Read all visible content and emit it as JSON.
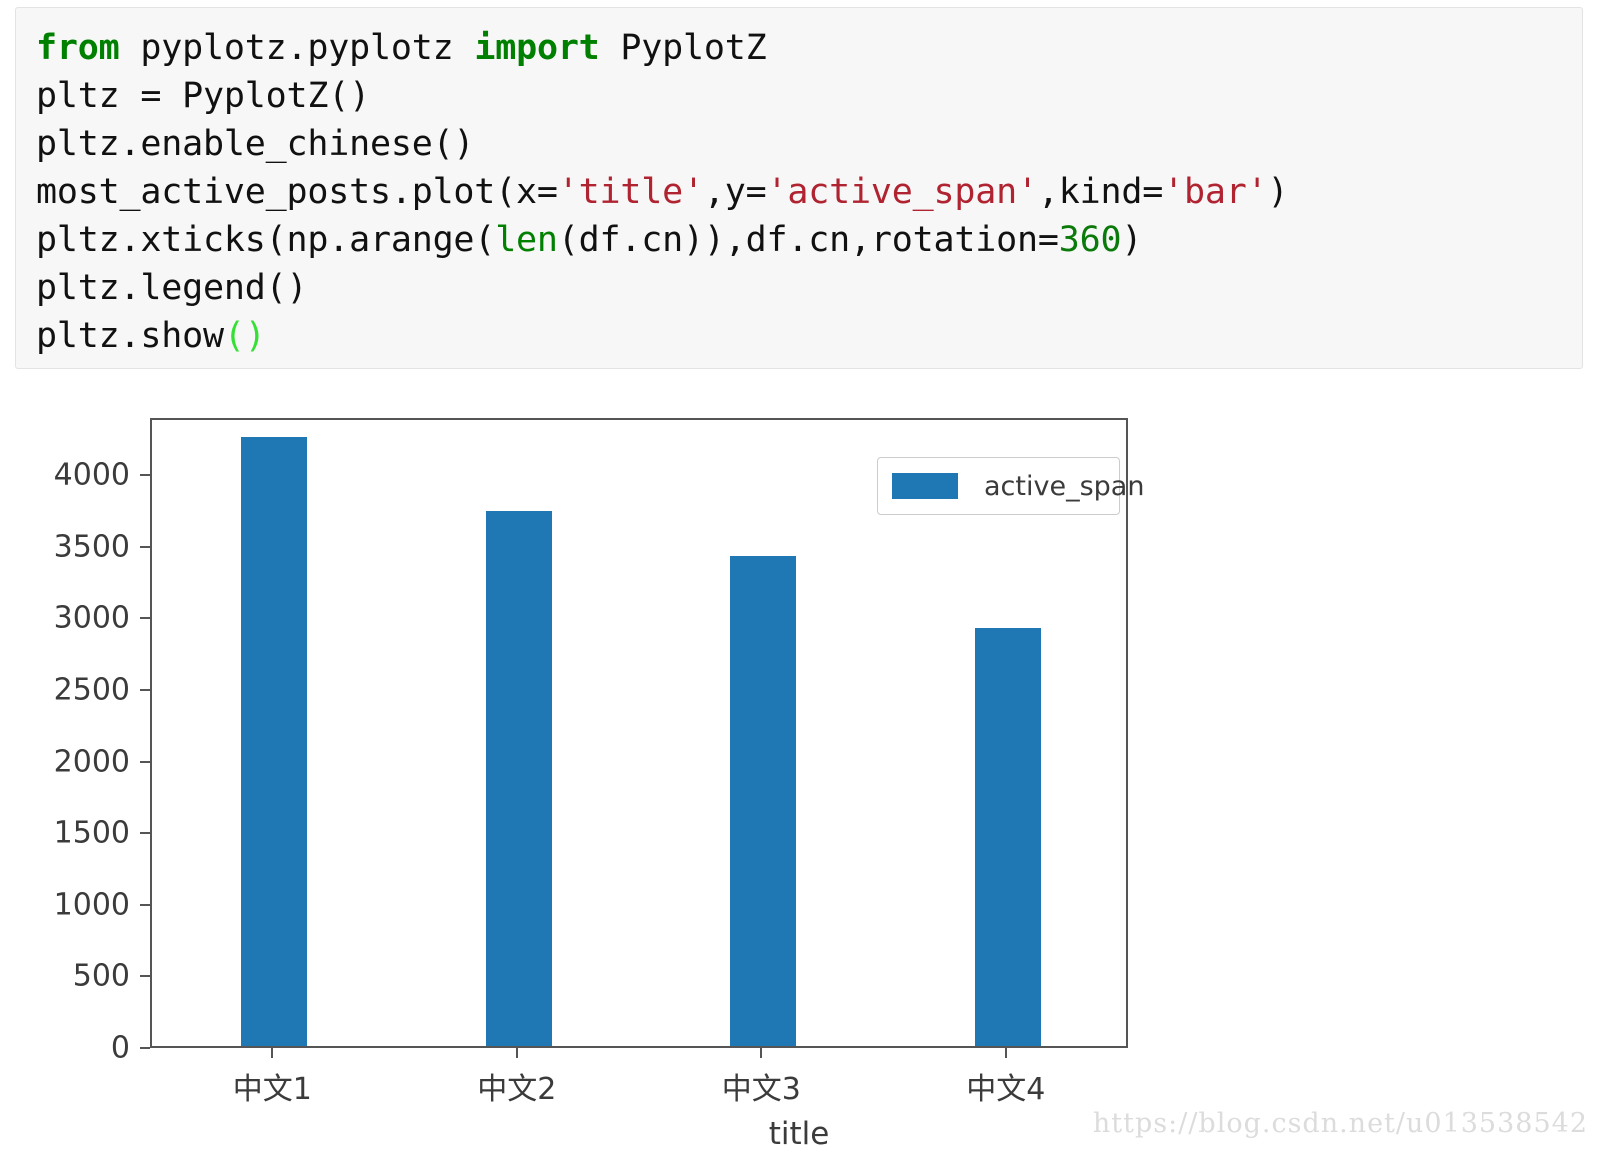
{
  "code_cell": {
    "language": "python",
    "lines": [
      {
        "id": "line1",
        "text": "from pyplotz.pyplotz import PyplotZ"
      },
      {
        "id": "line2",
        "text": "pltz = PyplotZ()"
      },
      {
        "id": "line3",
        "text": "pltz.enable_chinese()"
      },
      {
        "id": "line4",
        "text": "most_active_posts.plot(x='title',y='active_span',kind='bar')"
      },
      {
        "id": "line5",
        "text": "pltz.xticks(np.arange(len(df.cn)),df.cn,rotation=360)"
      },
      {
        "id": "line6",
        "text": "pltz.legend()"
      },
      {
        "id": "line7",
        "text": "pltz.show()"
      }
    ],
    "tokens": {
      "kw_from": "from",
      "kw_import": "import",
      "mod_path": " pyplotz.pyplotz ",
      "cls_name": " PyplotZ",
      "l2": "pltz = PyplotZ()",
      "l3": "pltz.enable_chinese()",
      "l4_a": "most_active_posts.plot(x=",
      "l4_s1": "'title'",
      "l4_b": ",y=",
      "l4_s2": "'active_span'",
      "l4_c": ",kind=",
      "l4_s3": "'bar'",
      "l4_d": ")",
      "l5_a": "pltz.xticks(np.arange(",
      "l5_len": "len",
      "l5_b": "(df.cn)),df.cn,rotation=",
      "l5_num": "360",
      "l5_c": ")",
      "l6": "pltz.legend()",
      "l7_a": "pltz.show",
      "l7_parens": "()"
    },
    "colors": {
      "keyword": "#008000",
      "string": "#b02330",
      "number": "#0b7a0b",
      "bracket_highlight": "#35e035",
      "text": "#111111",
      "background": "#f7f7f7",
      "border": "#e3e3e3"
    }
  },
  "chart_data": {
    "type": "bar",
    "title": "",
    "xlabel": "title",
    "ylabel": "",
    "categories": [
      "中文1",
      "中文2",
      "中文3",
      "中文4"
    ],
    "values": [
      4250,
      3740,
      3420,
      2920
    ],
    "series": [
      {
        "name": "active_span",
        "values": [
          4250,
          3740,
          3420,
          2920
        ]
      }
    ],
    "yticks": [
      0,
      500,
      1000,
      1500,
      2000,
      2500,
      3000,
      3500,
      4000
    ],
    "ytick_labels": [
      "0",
      "500",
      "1000",
      "1500",
      "2000",
      "2500",
      "3000",
      "3500",
      "4000"
    ],
    "ylim": [
      0,
      4400
    ],
    "xtick_labels": [
      "中文1",
      "中文2",
      "中文3",
      "中文4"
    ],
    "grid": false,
    "legend": {
      "position": "upper right",
      "entries": [
        {
          "label": "active_span",
          "color": "#1f77b4"
        }
      ]
    },
    "bar_color": "#1f77b4",
    "axis_color": "#555555",
    "tick_label_color": "#3b3b3b"
  },
  "watermark": {
    "text": "https://blog.csdn.net/u013538542"
  }
}
